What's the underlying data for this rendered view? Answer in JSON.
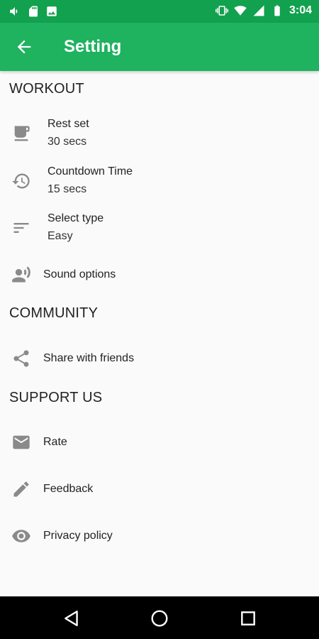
{
  "status_bar": {
    "time": "3:04",
    "left_icons": [
      "volume-icon",
      "sd-card-icon",
      "image-icon"
    ],
    "right_icons": [
      "vibrate-icon",
      "wifi-icon",
      "signal-icon",
      "battery-icon"
    ]
  },
  "app_bar": {
    "title": "Setting",
    "back_icon": "arrow-back-icon",
    "color": "#1fb25f"
  },
  "sections": {
    "workout": {
      "title": "WORKOUT",
      "items": [
        {
          "label": "Rest set",
          "value": "30 secs",
          "icon": "coffee-cup-icon"
        },
        {
          "label": "Countdown Time",
          "value": "15 secs",
          "icon": "history-icon"
        },
        {
          "label": "Select type",
          "value": "Easy",
          "icon": "sort-icon"
        },
        {
          "label": "Sound options",
          "icon": "voice-icon"
        }
      ]
    },
    "community": {
      "title": "COMMUNITY",
      "items": [
        {
          "label": "Share with friends",
          "icon": "share-icon"
        }
      ]
    },
    "support": {
      "title": "SUPPORT US",
      "items": [
        {
          "label": "Rate",
          "icon": "mail-icon"
        },
        {
          "label": "Feedback",
          "icon": "pencil-icon"
        },
        {
          "label": "Privacy policy",
          "icon": "eye-icon"
        }
      ]
    }
  },
  "nav_bar": {
    "buttons": [
      "back-triangle-icon",
      "home-circle-icon",
      "recents-square-icon"
    ]
  }
}
